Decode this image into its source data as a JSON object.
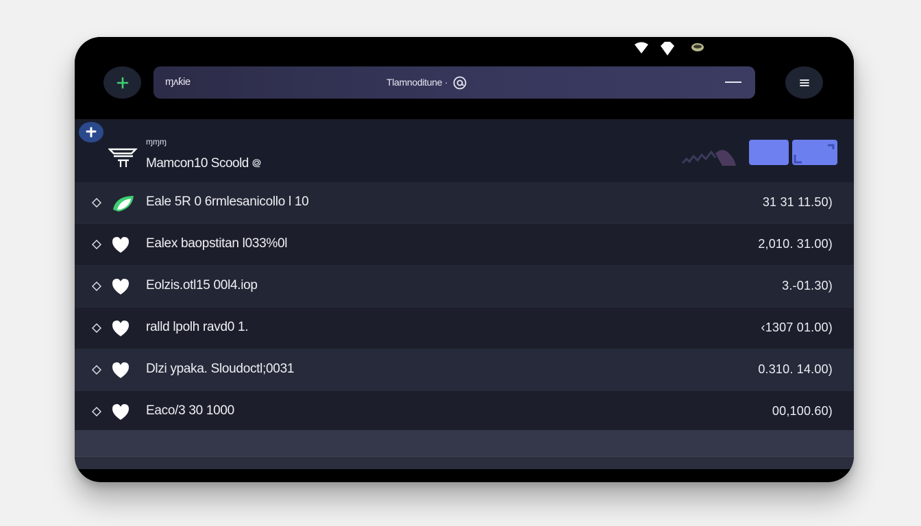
{
  "status_bar": {
    "icons": [
      "wifi-icon",
      "diamond-icon",
      "battery-icon"
    ]
  },
  "topbar": {
    "add_icon": "plus-icon",
    "menu_icon": "menu-icon",
    "search": {
      "left_text": "ɱʌƙie",
      "center_text": "Tlamnoditune ·",
      "center_icon": "at-icon"
    }
  },
  "header": {
    "badge_icon": "plus-icon",
    "logo_icon": "layers-icon",
    "small_label": "ɱɱɱ",
    "title": "Mamcon10 Scoold ᪤"
  },
  "rows": [
    {
      "label": "Eale 5R 0 6rmlesanicollo l 10",
      "value": "31 31 11.50)",
      "icon": "leaf-icon"
    },
    {
      "label": "Ealex baopstitan l033%0l",
      "value": "2,010. 31.00)",
      "icon": "heart-icon"
    },
    {
      "label": "Eolzis.otl15 00l4.iop",
      "value": "3.-01.30)",
      "icon": "heart-icon"
    },
    {
      "label": "ralld lpolh ravd0 1.",
      "value": "‹1307 01.00)",
      "icon": "heart-icon"
    },
    {
      "label": "Dlzi ypaka. Sloudoctl;0031",
      "value": "0.310. 14.00)",
      "icon": "heart-icon"
    },
    {
      "label": "Eaco/3 30 1000",
      "value": "00,100.60)",
      "icon": "heart-icon"
    }
  ],
  "colors": {
    "accent_green": "#3ecf72",
    "accent_blue": "#6e7ff0",
    "panel": "#191d2b"
  }
}
